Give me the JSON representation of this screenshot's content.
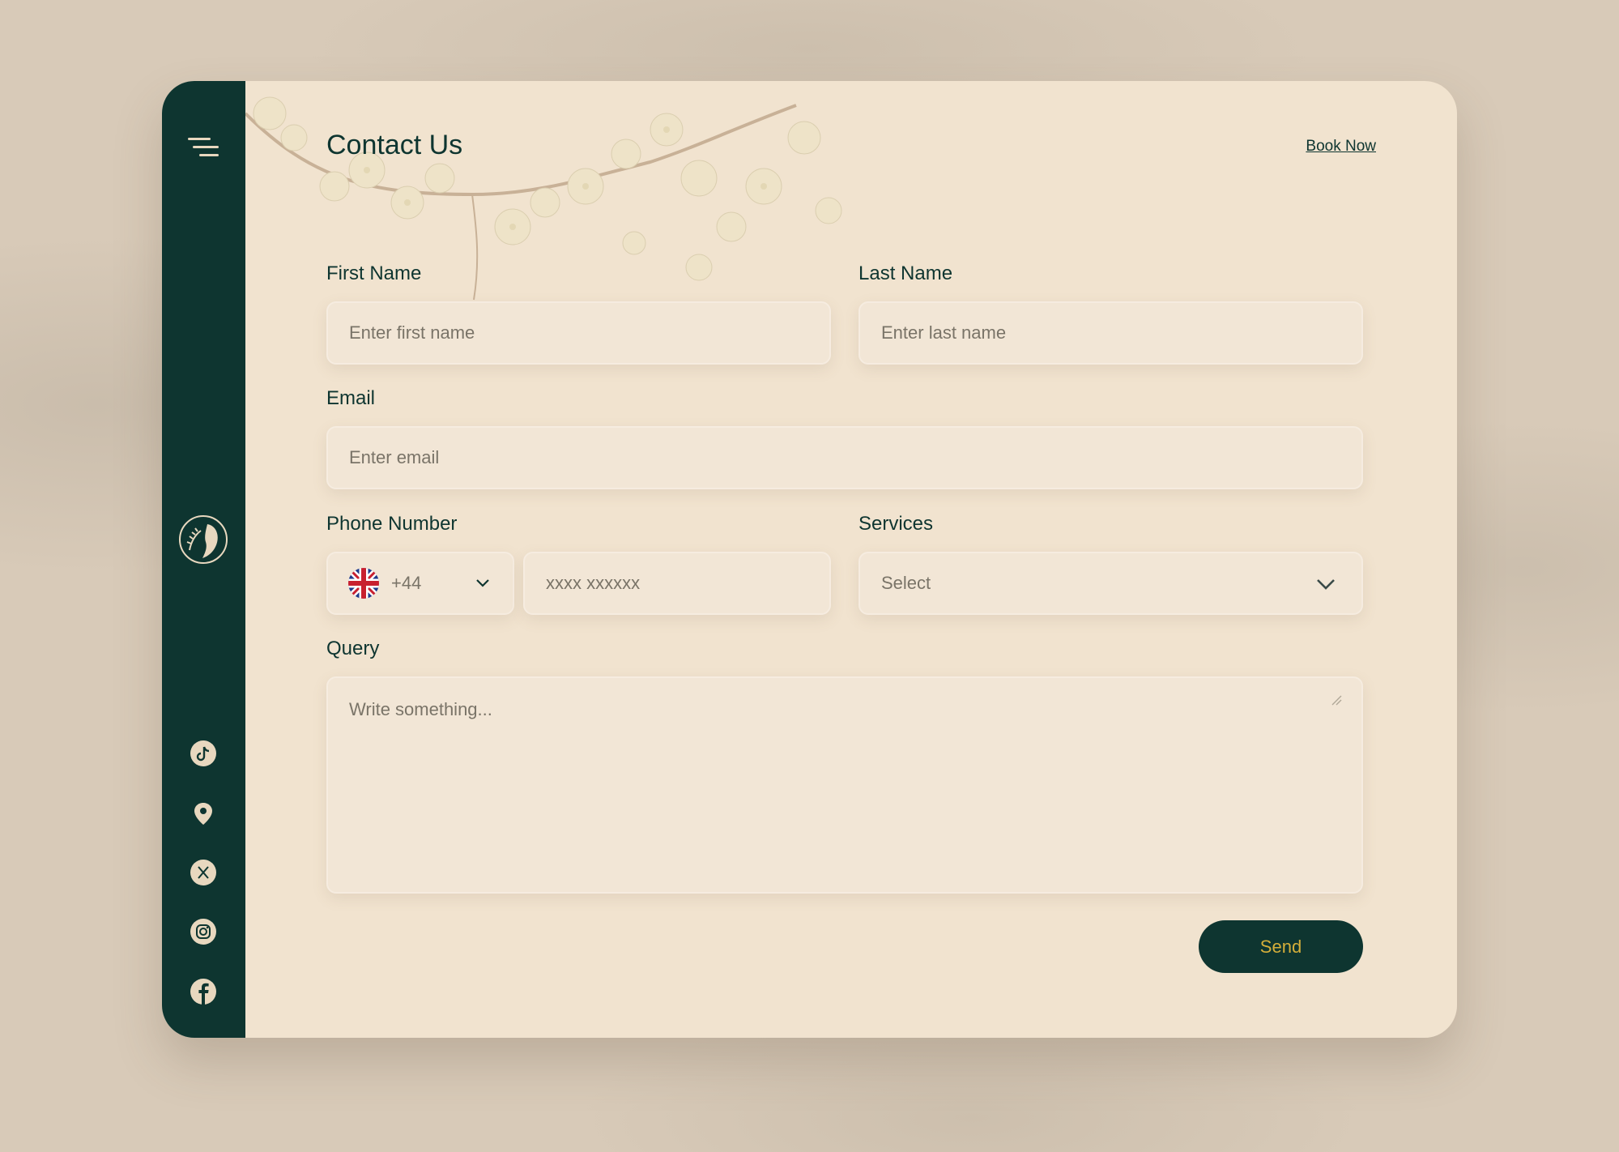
{
  "header": {
    "title": "Contact Us",
    "book_now": "Book Now"
  },
  "form": {
    "first_name": {
      "label": "First Name",
      "placeholder": "Enter first name"
    },
    "last_name": {
      "label": "Last Name",
      "placeholder": "Enter last name"
    },
    "email": {
      "label": "Email",
      "placeholder": "Enter email"
    },
    "phone": {
      "label": "Phone Number",
      "country_code": "+44",
      "placeholder": "xxxx xxxxxx"
    },
    "services": {
      "label": "Services",
      "selected": "Select"
    },
    "query": {
      "label": "Query",
      "placeholder": "Write something..."
    },
    "send_label": "Send"
  },
  "sidebar": {
    "icons": [
      "menu-icon",
      "logo-icon",
      "tiktok-icon",
      "location-icon",
      "x-icon",
      "instagram-icon",
      "facebook-icon"
    ]
  },
  "colors": {
    "sidebar": "#0e3530",
    "card": "#f1e3cf",
    "accent_text": "#d4ae3a"
  }
}
